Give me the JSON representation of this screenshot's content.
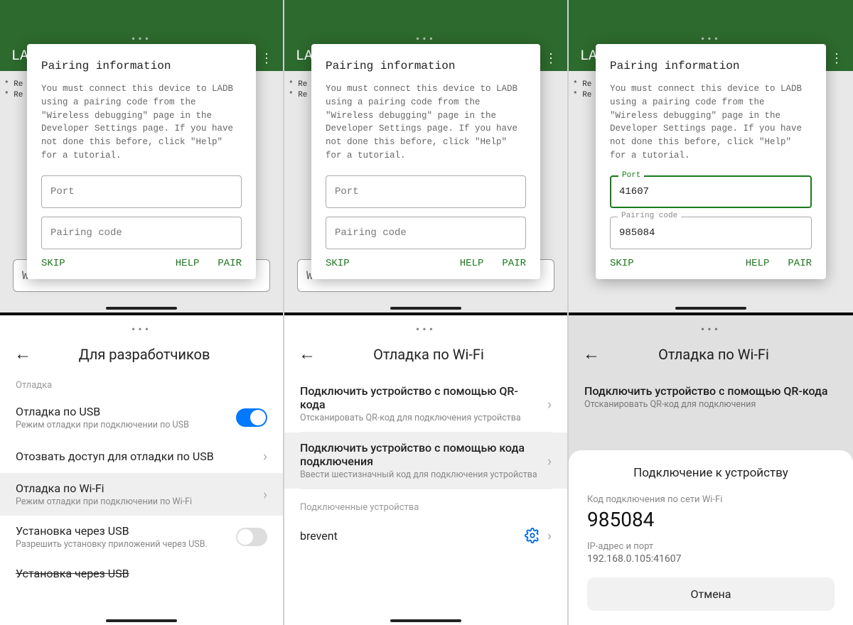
{
  "dialog": {
    "title": "Pairing information",
    "body": "You must connect this device to LADB using a pairing code from the \"Wireless debugging\" page in the Developer Settings page. If you have not done this before, click \"Help\" for a tutorial.",
    "port_placeholder": "Port",
    "pairing_placeholder": "Pairing code",
    "port_label": "Port",
    "pairing_label": "Pairing code",
    "port_value": "41607",
    "pairing_value": "985084",
    "skip": "SKIP",
    "help": "HELP",
    "pair": "PAIR"
  },
  "background": {
    "app_abbrev": "LA",
    "log_line1": "* Re",
    "log_line2": "* Re",
    "input_char": "W"
  },
  "col1_settings": {
    "title": "Для разработчиков",
    "section": "Отладка",
    "usb_debug": "Отладка по USB",
    "usb_debug_sub": "Режим отладки при подключении по USB",
    "revoke": "Отозвать доступ для отладки по USB",
    "wifi_debug": "Отладка по Wi-Fi",
    "wifi_debug_sub": "Режим отладки при подключении по Wi-Fi",
    "install_usb": "Установка через USB",
    "install_usb_sub": "Разрешить установку приложений через USB.",
    "install_usb2": "Установка через USB"
  },
  "col2_settings": {
    "title": "Отладка по Wi-Fi",
    "qr_title": "Подключить устройство с помощью QR-кода",
    "qr_sub": "Отсканировать QR-код для подключения устройства",
    "code_title": "Подключить устройство с помощью кода подключения",
    "code_sub": "Ввести шестизначный код для подключения устройства",
    "connected_section": "Подключенные устройства",
    "device": "brevent"
  },
  "col3_settings": {
    "title": "Отладка по Wi-Fi",
    "qr_title": "Подключить устройство с помощью QR-кода",
    "qr_sub": "Отсканировать QR-код для подключения"
  },
  "sheet": {
    "title": "Подключение к устройству",
    "code_label": "Код подключения по сети Wi-Fi",
    "code": "985084",
    "ip_label": "IP-адрес и порт",
    "ip_value": "192.168.0.105:41607",
    "cancel": "Отмена"
  }
}
